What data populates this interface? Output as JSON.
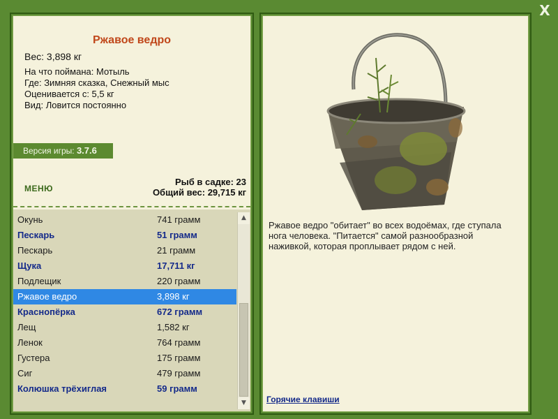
{
  "window": {
    "close_label": "X"
  },
  "info": {
    "title": "Ржавое ведро",
    "weight_line": "Вес: 3,898 кг",
    "caught_on": "На что поймана: Мотыль",
    "location": "Где: Зимняя сказка, Снежный мыс",
    "valued_from": "Оценивается с: 5,5 кг",
    "type": "Вид: Ловится постоянно"
  },
  "version": {
    "label": "Версия игры:",
    "value": "3.7.6"
  },
  "menu": {
    "label": "МЕНЮ"
  },
  "stats": {
    "fish_count": "Рыб в садке: 23",
    "total_weight": "Общий вес: 29,715 кг"
  },
  "catch_list": [
    {
      "name": "Окунь",
      "weight": "741 грамм",
      "bold": false
    },
    {
      "name": "Пескарь",
      "weight": "51 грамм",
      "bold": true
    },
    {
      "name": "Пескарь",
      "weight": "21 грамм",
      "bold": false
    },
    {
      "name": "Щука",
      "weight": "17,711 кг",
      "bold": true
    },
    {
      "name": "Подлещик",
      "weight": "220 грамм",
      "bold": false
    },
    {
      "name": "Ржавое ведро",
      "weight": "3,898 кг",
      "bold": false,
      "selected": true
    },
    {
      "name": "Краснопёрка",
      "weight": "672 грамм",
      "bold": true
    },
    {
      "name": "Лещ",
      "weight": "1,582 кг",
      "bold": false
    },
    {
      "name": "Ленок",
      "weight": "764 грамм",
      "bold": false
    },
    {
      "name": "Густера",
      "weight": "175 грамм",
      "bold": false
    },
    {
      "name": "Сиг",
      "weight": "479 грамм",
      "bold": false
    },
    {
      "name": "Колюшка трёхиглая",
      "weight": "59 грамм",
      "bold": true
    }
  ],
  "description": "Ржавое ведро \"обитает\" во всех водоёмах, где ступала нога человека. \"Питается\" самой разнообразной наживкой, которая проплывает рядом с ней.",
  "hotkeys": {
    "label": "Горячие клавиши"
  },
  "colors": {
    "frame": "#5a8a32",
    "panel": "#f5f2dc",
    "list_bg": "#d9d7b9",
    "title": "#c0471a",
    "bold_item": "#142a8a",
    "selection": "#2f88e4"
  },
  "icons": {
    "close": "close-icon",
    "scroll_up": "arrow-up-icon",
    "scroll_down": "arrow-down-icon"
  }
}
